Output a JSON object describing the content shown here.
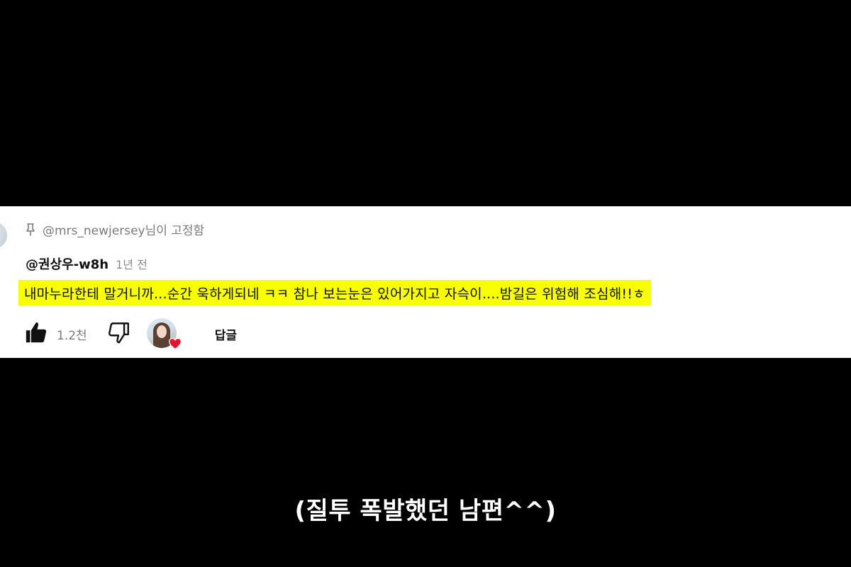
{
  "comment": {
    "pinned_by_user": "@mrs_newjersey",
    "pinned_suffix": "님이 고정함",
    "author": "@권상우-w8h",
    "timestamp": "1년 전",
    "text": "내마누라한테 말거니까...순간 욱하게되네 ㅋㅋ 참나 보는눈은 있어가지고 자슥이....밤길은 위험해  조심해!!ㅎ",
    "highlight_color": "#f7ff00",
    "like_count": "1.2천",
    "reply_label": "답글",
    "icons": {
      "pin": "pin-icon",
      "like": "thumbs-up-icon",
      "dislike": "thumbs-down-icon",
      "creator_heart": "heart-icon"
    }
  },
  "subtitle": {
    "text": "(질투 폭발했던 남편^^)"
  }
}
